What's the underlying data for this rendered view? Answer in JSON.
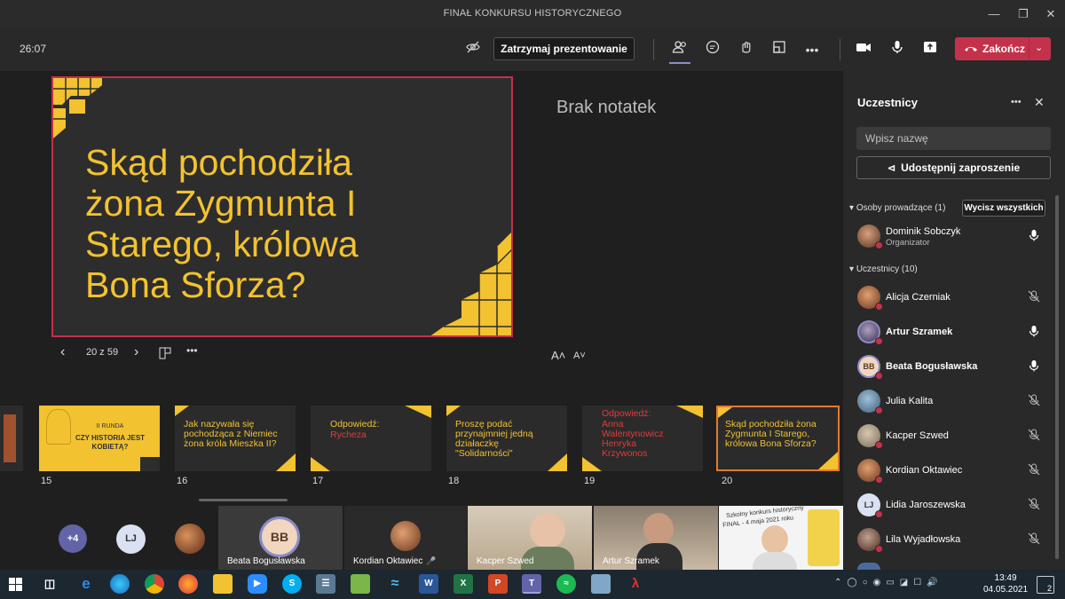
{
  "window": {
    "title": "FINAŁ KONKURSU HISTORYCZNEGO"
  },
  "meeting": {
    "timer": "26:07",
    "stop_presenting": "Zatrzymaj prezentowanie",
    "end_label": "Zakończ"
  },
  "presentation": {
    "current_slide_text": "Skąd pochodziła żona Zygmunta I Starego, królowa Bona Sforza?",
    "counter": "20 z 59",
    "notes": "Brak notatek",
    "font_up": "A˄",
    "font_down": "A˅"
  },
  "thumbnails": [
    {
      "num": "15",
      "line1": "II RUNDA",
      "line2": "CZY HISTORIA JEST KOBIETĄ?"
    },
    {
      "num": "16",
      "text": "Jak nazywała się pochodząca z Niemiec żona króla Mieszka II?"
    },
    {
      "num": "17",
      "text": "Odpowiedź:",
      "answer": "Rycheza"
    },
    {
      "num": "18",
      "text": "Proszę podać przynajmniej jedną działaczkę \"Solidarności\""
    },
    {
      "num": "19",
      "text": "Odpowiedź:",
      "answer": "Anna Walentynowicz Henryka Krzywonos"
    },
    {
      "num": "20",
      "text": "Skąd pochodziła żona Zygmunta I Starego, królowa Bona Sforza?"
    }
  ],
  "gallery": {
    "more": "+4",
    "lj": "LJ",
    "tiles": [
      {
        "initials": "BB",
        "name": "Beata Bogusławska"
      },
      {
        "name": "Kordian Oktawiec"
      },
      {
        "name": "Kacper Szwed"
      },
      {
        "name": "Artur Szramek"
      }
    ],
    "poster_line1": "Szkolny konkurs historyczny",
    "poster_line2": "FINAŁ - 4 maja 2021 roku"
  },
  "panel": {
    "title": "Uczestnicy",
    "search_placeholder": "Wpisz nazwę",
    "share": "Udostępnij zaproszenie",
    "presenters_header": "Osoby prowadzące (1)",
    "clear_all": "Wycisz wszystkich",
    "attendees_header": "Uczestnicy (10)",
    "presenters": [
      {
        "name": "Dominik Sobczyk",
        "role": "Organizator"
      }
    ],
    "attendees": [
      {
        "name": "Alicja Czerniak"
      },
      {
        "name": "Artur Szramek"
      },
      {
        "initials": "BB",
        "name": "Beata Bogusławska"
      },
      {
        "name": "Julia Kalita"
      },
      {
        "name": "Kacper Szwed"
      },
      {
        "name": "Kordian Oktawiec"
      },
      {
        "initials": "LJ",
        "name": "Lidia Jaroszewska"
      },
      {
        "name": "Lila Wyjadłowska"
      }
    ]
  },
  "taskbar": {
    "time": "13:49",
    "date": "04.05.2021",
    "notif_count": "2"
  },
  "colors": {
    "accent": "#c4314b",
    "slide_yellow": "#f2c230",
    "thumb_orange": "#e07a2e"
  }
}
